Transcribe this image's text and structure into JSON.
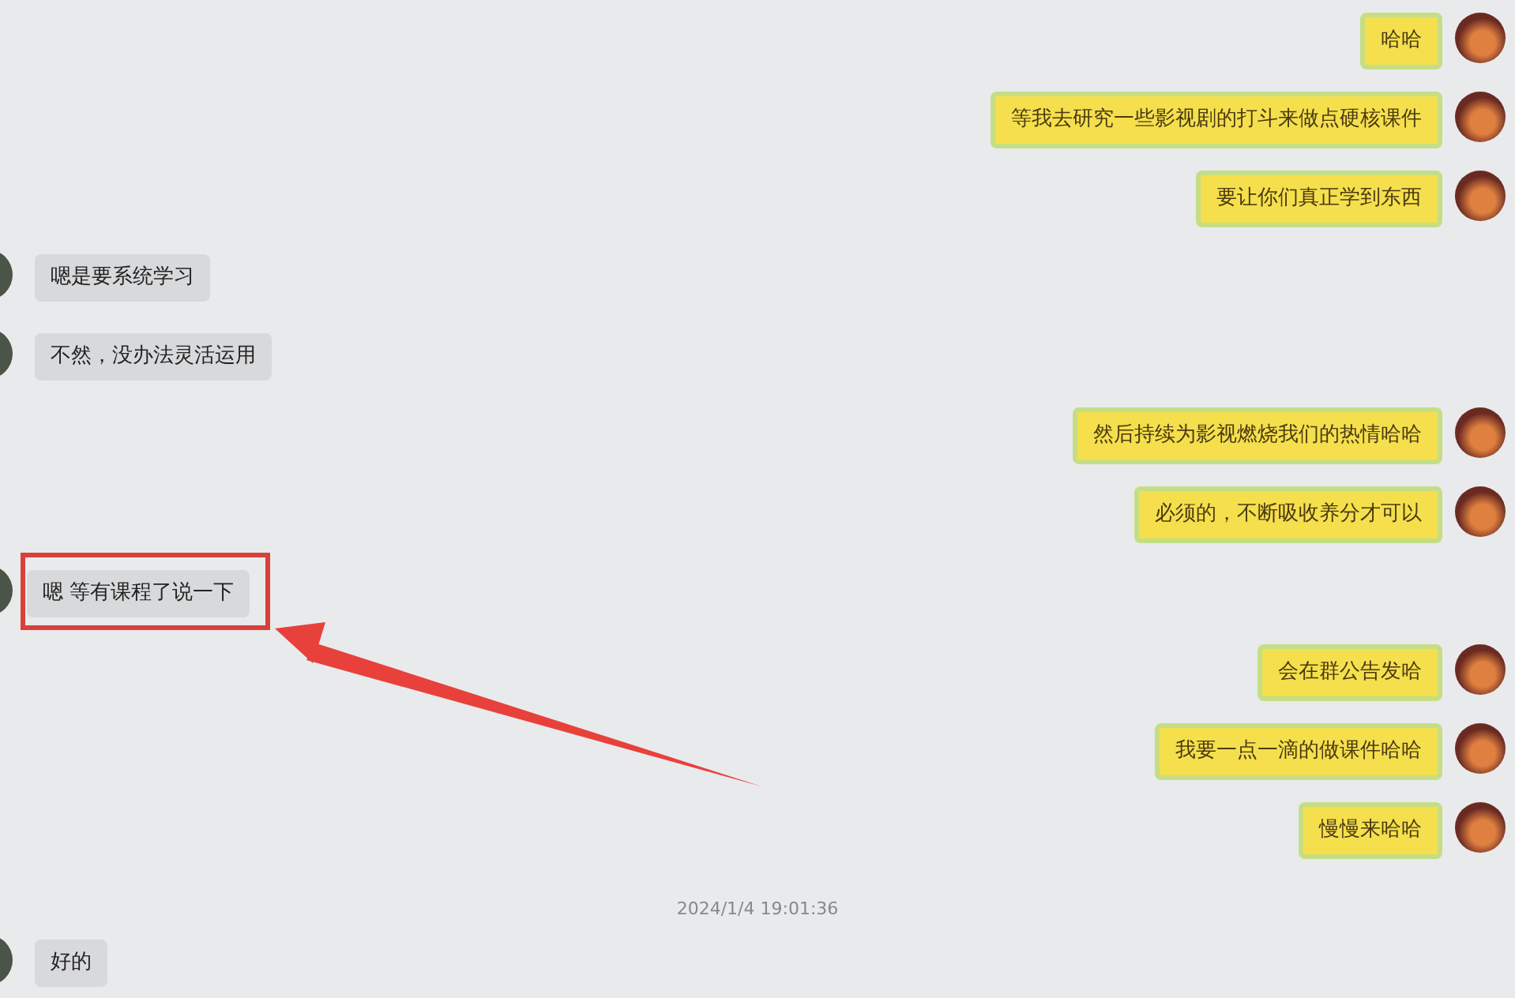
{
  "chat": {
    "items": [
      {
        "kind": "sent",
        "text": "哈哈",
        "highlighted": false
      },
      {
        "kind": "sent",
        "text": "等我去研究一些影视剧的打斗来做点硬核课件",
        "highlighted": false
      },
      {
        "kind": "sent",
        "text": "要让你们真正学到东西",
        "highlighted": false
      },
      {
        "kind": "received",
        "text": "嗯是要系统学习",
        "highlighted": false
      },
      {
        "kind": "received",
        "text": "不然，没办法灵活运用",
        "highlighted": false
      },
      {
        "kind": "sent",
        "text": "然后持续为影视燃烧我们的热情哈哈",
        "highlighted": false
      },
      {
        "kind": "sent",
        "text": "必须的，不断吸收养分才可以",
        "highlighted": false
      },
      {
        "kind": "received",
        "text": "嗯 等有课程了说一下",
        "highlighted": true
      },
      {
        "kind": "sent",
        "text": "会在群公告发哈",
        "highlighted": false
      },
      {
        "kind": "sent",
        "text": "我要一点一滴的做课件哈哈",
        "highlighted": false
      },
      {
        "kind": "sent",
        "text": "慢慢来哈哈",
        "highlighted": false
      },
      {
        "kind": "timestamp",
        "text": "2024/1/4 19:01:36"
      },
      {
        "kind": "received",
        "text": "好的",
        "highlighted": false
      }
    ]
  }
}
